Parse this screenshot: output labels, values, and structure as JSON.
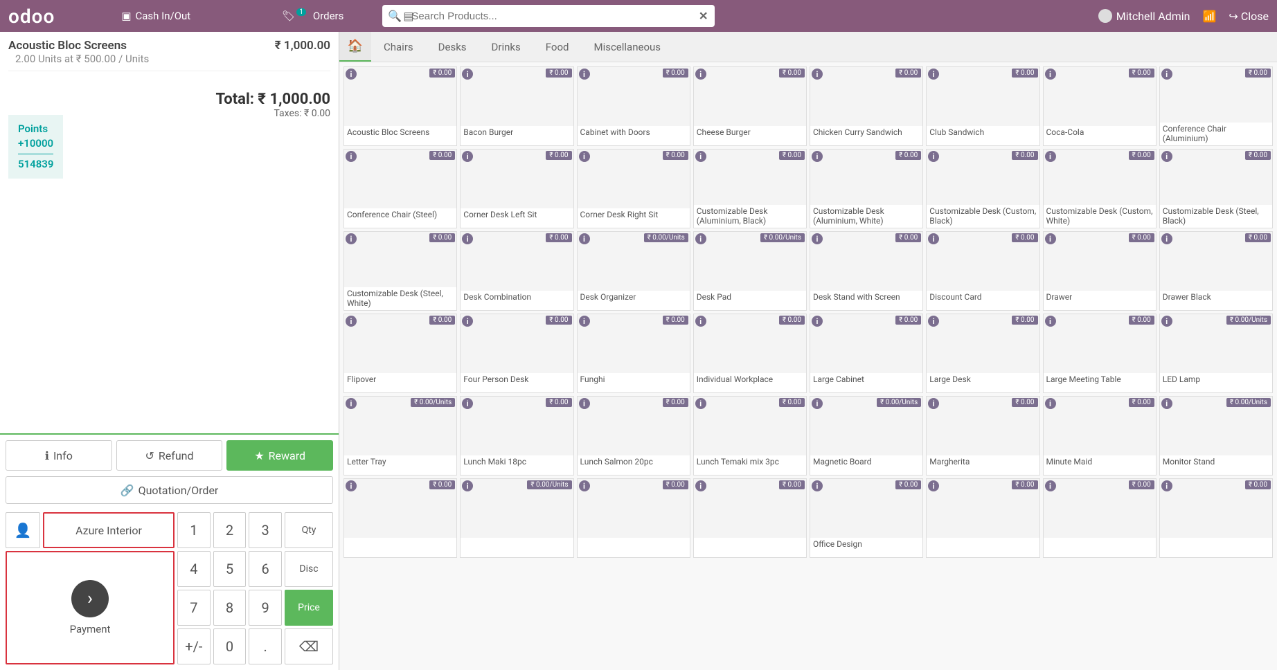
{
  "header": {
    "brand": "odoo",
    "cash_label": "Cash In/Out",
    "orders_label": "Orders",
    "orders_count": "1",
    "search_placeholder": "Search Products...",
    "user_name": "Mitchell Admin",
    "close_label": "Close"
  },
  "order": {
    "item_name": "Acoustic Bloc Screens",
    "item_qty_line": "2.00 Units at ₹ 500.00 / Units",
    "item_total": "₹ 1,000.00",
    "total_label": "Total: ₹ 1,000.00",
    "taxes_label": "Taxes: ₹ 0.00",
    "points_label": "Points",
    "points_add": "+10000",
    "points_balance": "514839"
  },
  "actions": {
    "info": "Info",
    "refund": "Refund",
    "reward": "Reward",
    "quotation": "Quotation/Order",
    "customer": "Azure Interior",
    "payment": "Payment"
  },
  "numpad": {
    "qty": "Qty",
    "disc": "Disc",
    "price": "Price",
    "n1": "1",
    "n2": "2",
    "n3": "3",
    "n4": "4",
    "n5": "5",
    "n6": "6",
    "n7": "7",
    "n8": "8",
    "n9": "9",
    "n0": "0",
    "sign": "+/-",
    "dot": "."
  },
  "categories": [
    "Chairs",
    "Desks",
    "Drinks",
    "Food",
    "Miscellaneous"
  ],
  "products": [
    {
      "name": "Acoustic Bloc Screens",
      "price": "₹ 0.00"
    },
    {
      "name": "Bacon Burger",
      "price": "₹ 0.00"
    },
    {
      "name": "Cabinet with Doors",
      "price": "₹ 0.00"
    },
    {
      "name": "Cheese Burger",
      "price": "₹ 0.00"
    },
    {
      "name": "Chicken Curry Sandwich",
      "price": "₹ 0.00"
    },
    {
      "name": "Club Sandwich",
      "price": "₹ 0.00"
    },
    {
      "name": "Coca-Cola",
      "price": "₹ 0.00"
    },
    {
      "name": "Conference Chair (Aluminium)",
      "price": "₹ 0.00"
    },
    {
      "name": "Conference Chair (Steel)",
      "price": "₹ 0.00"
    },
    {
      "name": "Corner Desk Left Sit",
      "price": "₹ 0.00"
    },
    {
      "name": "Corner Desk Right Sit",
      "price": "₹ 0.00"
    },
    {
      "name": "Customizable Desk (Aluminium, Black)",
      "price": "₹ 0.00"
    },
    {
      "name": "Customizable Desk (Aluminium, White)",
      "price": "₹ 0.00"
    },
    {
      "name": "Customizable Desk (Custom, Black)",
      "price": "₹ 0.00"
    },
    {
      "name": "Customizable Desk (Custom, White)",
      "price": "₹ 0.00"
    },
    {
      "name": "Customizable Desk (Steel, Black)",
      "price": "₹ 0.00"
    },
    {
      "name": "Customizable Desk (Steel, White)",
      "price": "₹ 0.00"
    },
    {
      "name": "Desk Combination",
      "price": "₹ 0.00"
    },
    {
      "name": "Desk Organizer",
      "price": "₹ 0.00/Units"
    },
    {
      "name": "Desk Pad",
      "price": "₹ 0.00/Units"
    },
    {
      "name": "Desk Stand with Screen",
      "price": "₹ 0.00"
    },
    {
      "name": "Discount Card",
      "price": "₹ 0.00"
    },
    {
      "name": "Drawer",
      "price": "₹ 0.00"
    },
    {
      "name": "Drawer Black",
      "price": "₹ 0.00"
    },
    {
      "name": "Flipover",
      "price": "₹ 0.00"
    },
    {
      "name": "Four Person Desk",
      "price": "₹ 0.00"
    },
    {
      "name": "Funghi",
      "price": "₹ 0.00"
    },
    {
      "name": "Individual Workplace",
      "price": "₹ 0.00"
    },
    {
      "name": "Large Cabinet",
      "price": "₹ 0.00"
    },
    {
      "name": "Large Desk",
      "price": "₹ 0.00"
    },
    {
      "name": "Large Meeting Table",
      "price": "₹ 0.00"
    },
    {
      "name": "LED Lamp",
      "price": "₹ 0.00/Units"
    },
    {
      "name": "Letter Tray",
      "price": "₹ 0.00/Units"
    },
    {
      "name": "Lunch Maki 18pc",
      "price": "₹ 0.00"
    },
    {
      "name": "Lunch Salmon 20pc",
      "price": "₹ 0.00"
    },
    {
      "name": "Lunch Temaki mix 3pc",
      "price": "₹ 0.00"
    },
    {
      "name": "Magnetic Board",
      "price": "₹ 0.00/Units"
    },
    {
      "name": "Margherita",
      "price": "₹ 0.00"
    },
    {
      "name": "Minute Maid",
      "price": "₹ 0.00"
    },
    {
      "name": "Monitor Stand",
      "price": "₹ 0.00/Units"
    },
    {
      "name": "",
      "price": "₹ 0.00"
    },
    {
      "name": "",
      "price": "₹ 0.00/Units"
    },
    {
      "name": "",
      "price": "₹ 0.00"
    },
    {
      "name": "",
      "price": "₹ 0.00"
    },
    {
      "name": "Office Design",
      "price": "₹ 0.00"
    },
    {
      "name": "",
      "price": "₹ 0.00"
    },
    {
      "name": "",
      "price": "₹ 0.00"
    },
    {
      "name": "",
      "price": "₹ 0.00"
    }
  ]
}
